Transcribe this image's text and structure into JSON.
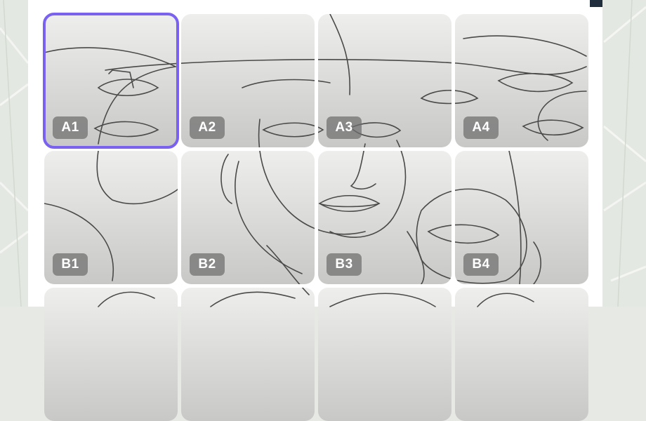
{
  "grid": {
    "selected": "A1",
    "tiles": [
      {
        "label": "A1"
      },
      {
        "label": "A2"
      },
      {
        "label": "A3"
      },
      {
        "label": "A4"
      },
      {
        "label": "B1"
      },
      {
        "label": "B2"
      },
      {
        "label": "B3"
      },
      {
        "label": "B4"
      },
      {
        "label": ""
      },
      {
        "label": ""
      },
      {
        "label": ""
      },
      {
        "label": ""
      }
    ]
  },
  "colors": {
    "selection": "#7b61f0",
    "tile_top": "#eeeeec",
    "tile_bottom": "#c8c8c6",
    "label_bg": "#6e6e6e",
    "line": "#4a4a4a"
  }
}
